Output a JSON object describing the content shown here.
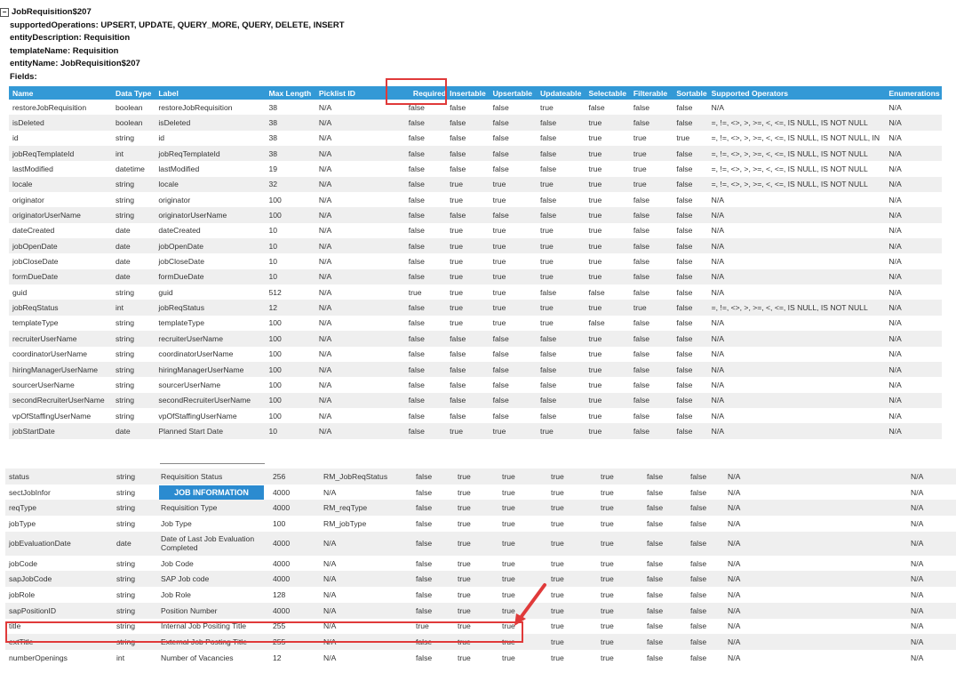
{
  "entity": {
    "title": "JobRequisition$207",
    "toggle": "−",
    "lines": [
      "supportedOperations: UPSERT, UPDATE, QUERY_MORE, QUERY, DELETE, INSERT",
      "entityDescription: Requisition",
      "templateName: Requisition",
      "entityName: JobRequisition$207",
      "Fields:"
    ]
  },
  "columns": [
    "Name",
    "Data Type",
    "Label",
    "Max Length",
    "Picklist ID",
    "Required",
    "Insertable",
    "Upsertable",
    "Updateable",
    "Selectable",
    "Filterable",
    "Sortable",
    "Supported Operators",
    "Enumerations"
  ],
  "rows": [
    [
      "restoreJobRequisition",
      "boolean",
      "restoreJobRequisition",
      "38",
      "N/A",
      "false",
      "false",
      "false",
      "true",
      "false",
      "false",
      "false",
      "N/A",
      "N/A"
    ],
    [
      "isDeleted",
      "boolean",
      "isDeleted",
      "38",
      "N/A",
      "false",
      "false",
      "false",
      "false",
      "true",
      "false",
      "false",
      "=, !=, <>, >, >=, <, <=, IS NULL, IS NOT NULL",
      "N/A"
    ],
    [
      "id",
      "string",
      "id",
      "38",
      "N/A",
      "false",
      "false",
      "false",
      "false",
      "true",
      "true",
      "true",
      "=, !=, <>, >, >=, <, <=, IS NULL, IS NOT NULL, IN",
      "N/A"
    ],
    [
      "jobReqTemplateId",
      "int",
      "jobReqTemplateId",
      "38",
      "N/A",
      "false",
      "false",
      "false",
      "false",
      "true",
      "true",
      "false",
      "=, !=, <>, >, >=, <, <=, IS NULL, IS NOT NULL",
      "N/A"
    ],
    [
      "lastModified",
      "datetime",
      "lastModified",
      "19",
      "N/A",
      "false",
      "false",
      "false",
      "false",
      "true",
      "true",
      "false",
      "=, !=, <>, >, >=, <, <=, IS NULL, IS NOT NULL",
      "N/A"
    ],
    [
      "locale",
      "string",
      "locale",
      "32",
      "N/A",
      "false",
      "true",
      "true",
      "true",
      "true",
      "true",
      "false",
      "=, !=, <>, >, >=, <, <=, IS NULL, IS NOT NULL",
      "N/A"
    ],
    [
      "originator",
      "string",
      "originator",
      "100",
      "N/A",
      "false",
      "true",
      "true",
      "false",
      "true",
      "false",
      "false",
      "N/A",
      "N/A"
    ],
    [
      "originatorUserName",
      "string",
      "originatorUserName",
      "100",
      "N/A",
      "false",
      "false",
      "false",
      "false",
      "true",
      "false",
      "false",
      "N/A",
      "N/A"
    ],
    [
      "dateCreated",
      "date",
      "dateCreated",
      "10",
      "N/A",
      "false",
      "true",
      "true",
      "true",
      "true",
      "false",
      "false",
      "N/A",
      "N/A"
    ],
    [
      "jobOpenDate",
      "date",
      "jobOpenDate",
      "10",
      "N/A",
      "false",
      "true",
      "true",
      "true",
      "true",
      "false",
      "false",
      "N/A",
      "N/A"
    ],
    [
      "jobCloseDate",
      "date",
      "jobCloseDate",
      "10",
      "N/A",
      "false",
      "true",
      "true",
      "true",
      "true",
      "false",
      "false",
      "N/A",
      "N/A"
    ],
    [
      "formDueDate",
      "date",
      "formDueDate",
      "10",
      "N/A",
      "false",
      "true",
      "true",
      "true",
      "true",
      "false",
      "false",
      "N/A",
      "N/A"
    ],
    [
      "guid",
      "string",
      "guid",
      "512",
      "N/A",
      "true",
      "true",
      "true",
      "false",
      "false",
      "false",
      "false",
      "N/A",
      "N/A"
    ],
    [
      "jobReqStatus",
      "int",
      "jobReqStatus",
      "12",
      "N/A",
      "false",
      "true",
      "true",
      "true",
      "true",
      "true",
      "false",
      "=, !=, <>, >, >=, <, <=, IS NULL, IS NOT NULL",
      "N/A"
    ],
    [
      "templateType",
      "string",
      "templateType",
      "100",
      "N/A",
      "false",
      "true",
      "true",
      "true",
      "false",
      "false",
      "false",
      "N/A",
      "N/A"
    ],
    [
      "recruiterUserName",
      "string",
      "recruiterUserName",
      "100",
      "N/A",
      "false",
      "false",
      "false",
      "false",
      "true",
      "false",
      "false",
      "N/A",
      "N/A"
    ],
    [
      "coordinatorUserName",
      "string",
      "coordinatorUserName",
      "100",
      "N/A",
      "false",
      "false",
      "false",
      "false",
      "true",
      "false",
      "false",
      "N/A",
      "N/A"
    ],
    [
      "hiringManagerUserName",
      "string",
      "hiringManagerUserName",
      "100",
      "N/A",
      "false",
      "false",
      "false",
      "false",
      "true",
      "false",
      "false",
      "N/A",
      "N/A"
    ],
    [
      "sourcerUserName",
      "string",
      "sourcerUserName",
      "100",
      "N/A",
      "false",
      "false",
      "false",
      "false",
      "true",
      "false",
      "false",
      "N/A",
      "N/A"
    ],
    [
      "secondRecruiterUserName",
      "string",
      "secondRecruiterUserName",
      "100",
      "N/A",
      "false",
      "false",
      "false",
      "false",
      "true",
      "false",
      "false",
      "N/A",
      "N/A"
    ],
    [
      "vpOfStaffingUserName",
      "string",
      "vpOfStaffingUserName",
      "100",
      "N/A",
      "false",
      "false",
      "false",
      "false",
      "true",
      "false",
      "false",
      "N/A",
      "N/A"
    ],
    [
      "jobStartDate",
      "date",
      "Planned Start Date",
      "10",
      "N/A",
      "false",
      "true",
      "true",
      "true",
      "true",
      "false",
      "false",
      "N/A",
      "N/A"
    ]
  ],
  "rows2": [
    [
      "status",
      "string",
      "Requisition Status",
      "256",
      "RM_JobReqStatus",
      "false",
      "true",
      "true",
      "true",
      "true",
      "false",
      "false",
      "N/A",
      "N/A"
    ],
    [
      "sectJobInfor",
      "string",
      "JOB INFORMATION",
      "4000",
      "N/A",
      "false",
      "true",
      "true",
      "true",
      "true",
      "false",
      "false",
      "N/A",
      "N/A"
    ],
    [
      "reqType",
      "string",
      "Requisition Type",
      "4000",
      "RM_reqType",
      "false",
      "true",
      "true",
      "true",
      "true",
      "false",
      "false",
      "N/A",
      "N/A"
    ],
    [
      "jobType",
      "string",
      "Job Type",
      "100",
      "RM_jobType",
      "false",
      "true",
      "true",
      "true",
      "true",
      "false",
      "false",
      "N/A",
      "N/A"
    ],
    [
      "jobEvaluationDate",
      "date",
      "Date of Last Job Evaluation Completed",
      "4000",
      "N/A",
      "false",
      "true",
      "true",
      "true",
      "true",
      "false",
      "false",
      "N/A",
      "N/A"
    ],
    [
      "jobCode",
      "string",
      "Job Code",
      "4000",
      "N/A",
      "false",
      "true",
      "true",
      "true",
      "true",
      "false",
      "false",
      "N/A",
      "N/A"
    ],
    [
      "sapJobCode",
      "string",
      "SAP Job code",
      "4000",
      "N/A",
      "false",
      "true",
      "true",
      "true",
      "true",
      "false",
      "false",
      "N/A",
      "N/A"
    ],
    [
      "jobRole",
      "string",
      "Job Role",
      "128",
      "N/A",
      "false",
      "true",
      "true",
      "true",
      "true",
      "false",
      "false",
      "N/A",
      "N/A"
    ],
    [
      "sapPositionID",
      "string",
      "Position Number",
      "4000",
      "N/A",
      "false",
      "true",
      "true",
      "true",
      "true",
      "false",
      "false",
      "N/A",
      "N/A"
    ],
    [
      "title",
      "string",
      "Internal Job Positing Title",
      "255",
      "N/A",
      "true",
      "true",
      "true",
      "true",
      "true",
      "false",
      "false",
      "N/A",
      "N/A"
    ],
    [
      "extTitle",
      "string",
      "External Job Posting Title",
      "255",
      "N/A",
      "false",
      "true",
      "true",
      "true",
      "true",
      "false",
      "false",
      "N/A",
      "N/A"
    ],
    [
      "numberOpenings",
      "int",
      "Number of Vacancies",
      "12",
      "N/A",
      "false",
      "true",
      "true",
      "true",
      "true",
      "false",
      "false",
      "N/A",
      "N/A"
    ]
  ],
  "highlight_color": "#e03a3a",
  "header_color": "#3399d6"
}
